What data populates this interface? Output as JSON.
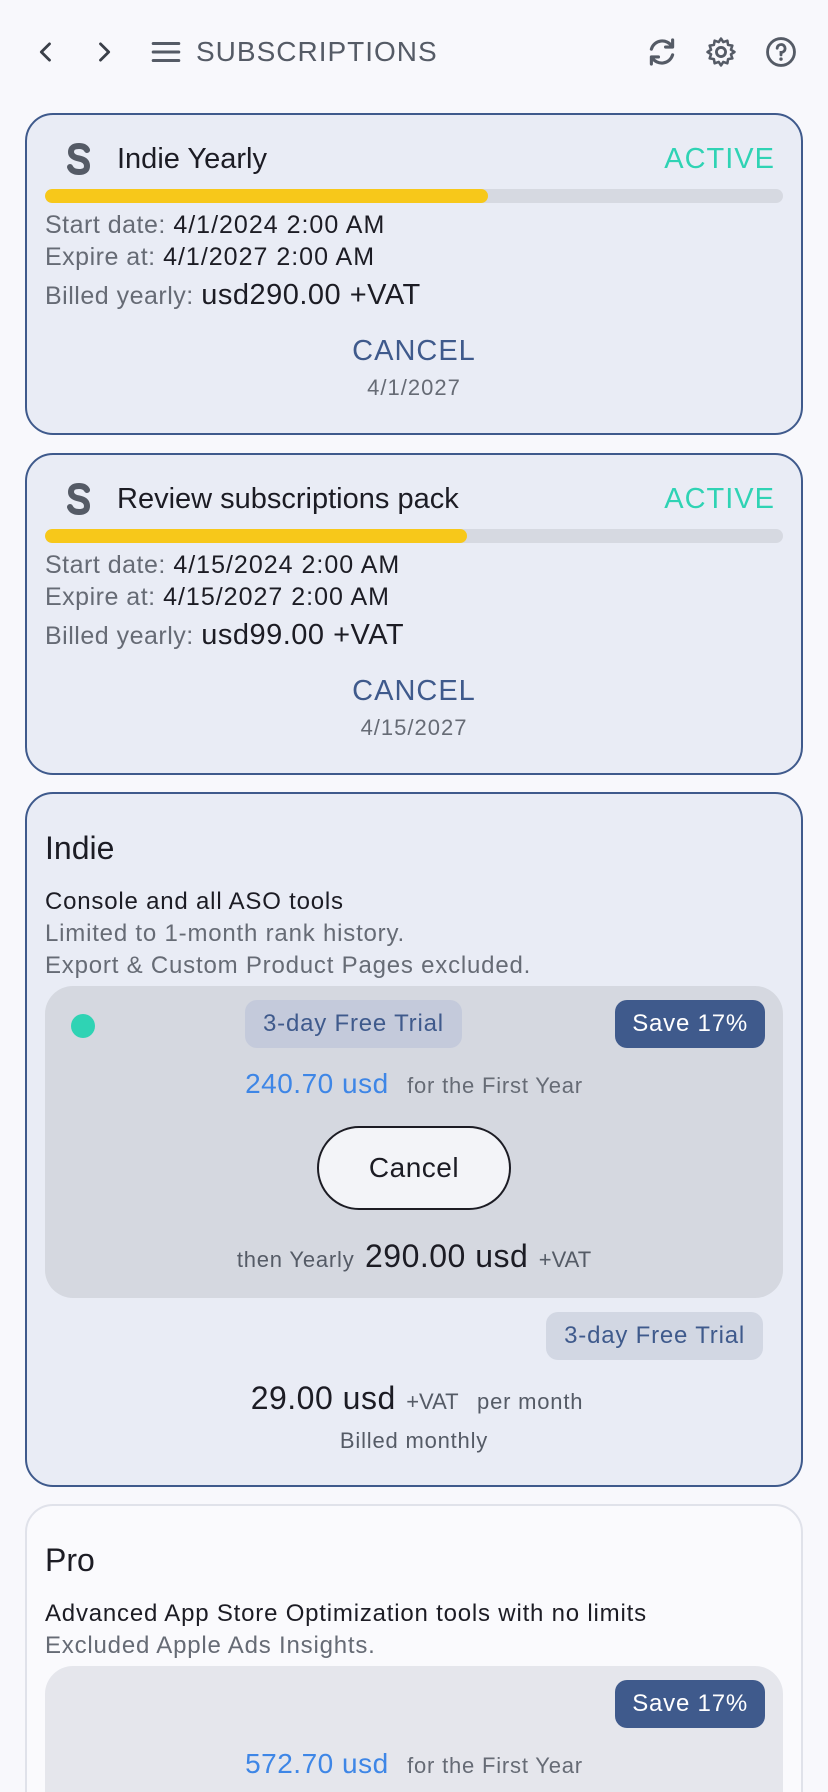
{
  "header": {
    "title": "SUBSCRIPTIONS",
    "back_icon": "chevron-left-icon",
    "forward_icon": "chevron-right-icon",
    "menu_icon": "hamburger-menu-icon",
    "refresh_icon": "refresh-icon",
    "settings_icon": "gear-icon",
    "help_icon": "help-icon"
  },
  "colors": {
    "accent": "#3f5a8c",
    "active": "#2fd3b4",
    "progress": "#f7c81a",
    "price_blue": "#3e86e6"
  },
  "subscriptions": [
    {
      "name": "Indie Yearly",
      "status": "ACTIVE",
      "progress_fraction": 0.6,
      "start_label": "Start date:",
      "start_value": "4/1/2024 2:00 AM",
      "expire_label": "Expire at:",
      "expire_value": "4/1/2027 2:00 AM",
      "billed_label": "Billed yearly:",
      "billed_value": "usd290.00 +VAT",
      "cancel_label": "CANCEL",
      "cancel_date": "4/1/2027"
    },
    {
      "name": "Review subscriptions pack",
      "status": "ACTIVE",
      "progress_fraction": 0.572,
      "start_label": "Start date:",
      "start_value": "4/15/2024 2:00 AM",
      "expire_label": "Expire at:",
      "expire_value": "4/15/2027 2:00 AM",
      "billed_label": "Billed yearly:",
      "billed_value": "usd99.00 +VAT",
      "cancel_label": "CANCEL",
      "cancel_date": "4/15/2027"
    }
  ],
  "plans": [
    {
      "name": "Indie",
      "description": "Console and all ASO tools",
      "notes": [
        "Limited to 1-month rank history.",
        "Export & Custom Product Pages excluded."
      ],
      "yearly_offer": {
        "selected": true,
        "trial": "3-day Free Trial",
        "save": "Save 17%",
        "first_year_price": "240.70 usd",
        "first_year_suffix": "for the First Year",
        "cancel_button": "Cancel",
        "then_label": "then Yearly",
        "then_price": "290.00 usd",
        "vat": "+VAT"
      },
      "monthly_offer": {
        "trial": "3-day Free Trial",
        "price": "29.00 usd",
        "vat": "+VAT",
        "per": "per month",
        "billed": "Billed monthly"
      }
    },
    {
      "name": "Pro",
      "description": "Advanced App Store Optimization tools with no limits",
      "notes": [
        "Excluded Apple Ads Insights."
      ],
      "yearly_offer": {
        "save": "Save 17%",
        "first_year_price": "572.70 usd",
        "first_year_suffix": "for the First Year"
      }
    }
  ]
}
